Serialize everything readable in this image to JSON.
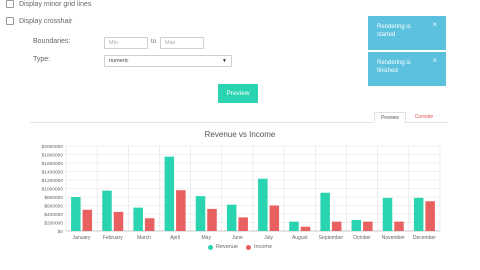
{
  "options": {
    "minor_grid_label": "Display minor grid lines",
    "crosshair_label": "Display crosshair"
  },
  "boundaries": {
    "label": "Boundaries:",
    "min_placeholder": "Min",
    "to_label": "to",
    "max_placeholder": "Max"
  },
  "type_field": {
    "label": "Type:",
    "selected": "numeric",
    "arrow": "▼"
  },
  "preview_button": "Preview",
  "toasts": [
    {
      "line1": "Rendering is",
      "line2": "started",
      "close": "×"
    },
    {
      "line1": "Rendering is",
      "line2": "finished",
      "close": "×"
    }
  ],
  "tabs": {
    "preview": "Preview",
    "console": "Console"
  },
  "colors": {
    "accent": "#2bd4b0",
    "toast": "#5bc1de",
    "revenue": "#2bd4b0",
    "income": "#e8605f"
  },
  "chart_data": {
    "type": "bar",
    "title": "Revenue vs Income",
    "categories": [
      "January",
      "February",
      "March",
      "April",
      "May",
      "June",
      "July",
      "August",
      "September",
      "October",
      "November",
      "December"
    ],
    "series": [
      {
        "name": "Revenue",
        "values": [
          800000,
          950000,
          550000,
          1750000,
          820000,
          620000,
          1230000,
          220000,
          900000,
          260000,
          780000,
          780000
        ]
      },
      {
        "name": "Income",
        "values": [
          500000,
          450000,
          300000,
          960000,
          520000,
          320000,
          600000,
          100000,
          220000,
          220000,
          220000,
          700000
        ]
      }
    ],
    "yticks": [
      "$0",
      "$200000",
      "$400000",
      "$600000",
      "$800000",
      "$1000000",
      "$1200000",
      "$1400000",
      "$1600000",
      "$1800000",
      "$2000000"
    ],
    "ylim": [
      0,
      2000000
    ],
    "grid": true,
    "legend_position": "bottom"
  }
}
